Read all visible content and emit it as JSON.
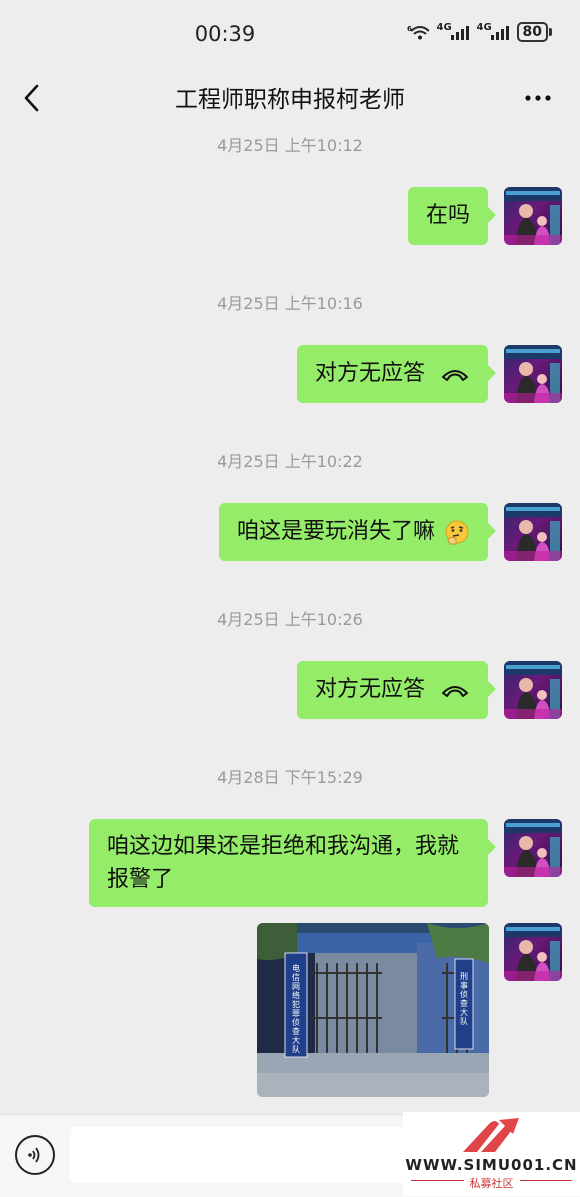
{
  "status_bar": {
    "time": "00:39",
    "network_1": "4G",
    "network_2": "4G",
    "sim_label": "6",
    "battery": "80"
  },
  "header": {
    "title": "工程师职称申报柯老师"
  },
  "messages": {
    "ts1": "4月25日 上午10:12",
    "m1": "在吗",
    "ts2": "4月25日 上午10:16",
    "m2": "对方无应答",
    "ts3": "4月25日 上午10:22",
    "m3": "咱这是要玩消失了嘛",
    "ts4": "4月25日 上午10:26",
    "m4": "对方无应答",
    "ts5": "4月28日 下午15:29",
    "m5": "咱这边如果还是拒绝和我沟通，我就报警了"
  },
  "photo": {
    "sign_left": "电信网络犯罪侦查大队",
    "sign_right": "刑事侦查大队"
  },
  "input": {
    "placeholder": ""
  },
  "watermark": {
    "url": "WWW.SIMU001.CN",
    "sub": "私募社区"
  },
  "icons": {
    "back": "chevron-left-icon",
    "more": "more-dots-icon",
    "voice": "voice-icon",
    "call": "phone-hangup-icon",
    "emoji": "thinking-face-icon"
  },
  "colors": {
    "bubble": "#95ec69",
    "background": "#ededed",
    "timestamp": "#9a9a9a"
  }
}
